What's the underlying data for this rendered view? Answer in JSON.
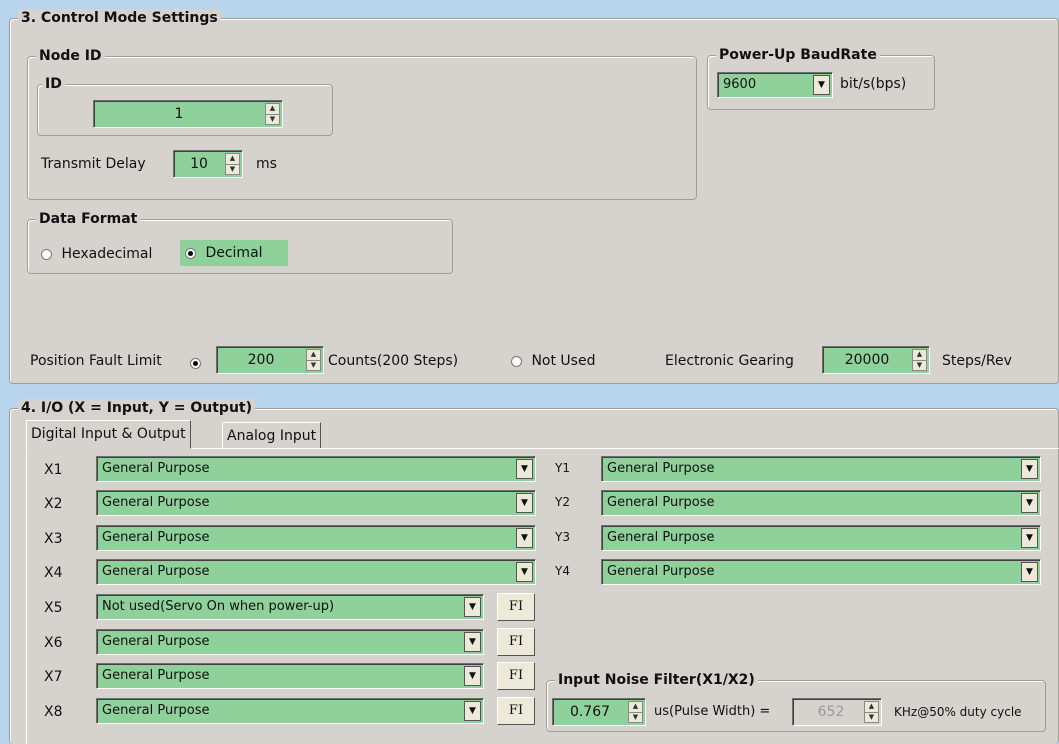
{
  "control_mode": {
    "title": "3. Control Mode Settings",
    "node_id": {
      "title": "Node ID",
      "id_group_title": "ID",
      "id_value": "1",
      "transmit_delay_label": "Transmit Delay",
      "transmit_delay_value": "10",
      "transmit_delay_unit": "ms"
    },
    "baud": {
      "title": "Power-Up BaudRate",
      "value": "9600",
      "unit": "bit/s(bps)"
    },
    "data_format": {
      "title": "Data Format",
      "hex_label": "Hexadecimal",
      "dec_label": "Decimal",
      "selected": "Decimal"
    },
    "position_fault": {
      "label": "Position Fault Limit",
      "value": "200",
      "counts_label": "Counts(200 Steps)",
      "not_used_label": "Not Used",
      "selected": "counts"
    },
    "gearing": {
      "label": "Electronic Gearing",
      "value": "20000",
      "unit": "Steps/Rev"
    }
  },
  "io": {
    "title": "4. I/O (X = Input, Y = Output)",
    "tabs": [
      "Digital Input & Output",
      "Analog Input"
    ],
    "active_tab": "Digital Input & Output",
    "inputs": [
      {
        "label": "X1",
        "value": "General Purpose"
      },
      {
        "label": "X2",
        "value": "General Purpose"
      },
      {
        "label": "X3",
        "value": "General Purpose"
      },
      {
        "label": "X4",
        "value": "General Purpose"
      },
      {
        "label": "X5",
        "value": "Not used(Servo On when power-up)",
        "fi": "FI"
      },
      {
        "label": "X6",
        "value": "General Purpose",
        "fi": "FI"
      },
      {
        "label": "X7",
        "value": "General Purpose",
        "fi": "FI"
      },
      {
        "label": "X8",
        "value": "General Purpose",
        "fi": "FI"
      }
    ],
    "outputs": [
      {
        "label": "Y1",
        "value": "General Purpose"
      },
      {
        "label": "Y2",
        "value": "General Purpose"
      },
      {
        "label": "Y3",
        "value": "General Purpose"
      },
      {
        "label": "Y4",
        "value": "General Purpose"
      }
    ],
    "noise_filter": {
      "title": "Input Noise Filter(X1/X2)",
      "pulse_value": "0.767",
      "pulse_label": "us(Pulse Width) =",
      "khz_value": "652",
      "khz_label": "KHz@50% duty cycle"
    }
  },
  "colors": {
    "field_green": "#8fd19a",
    "panel": "#d6d3ce",
    "window_bg": "#b8d3ec"
  }
}
